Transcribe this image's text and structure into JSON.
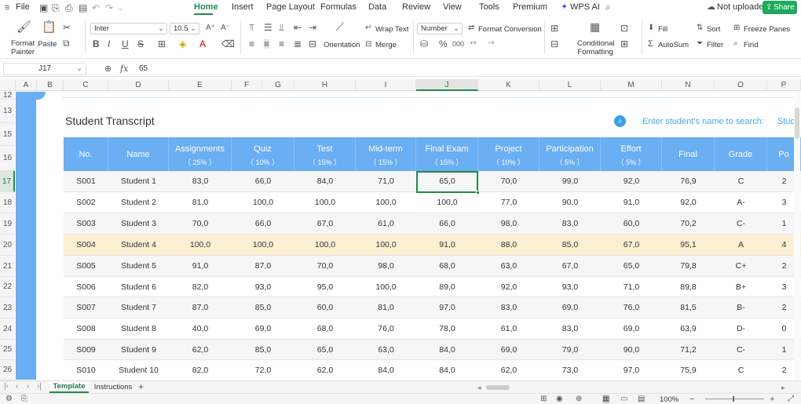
{
  "menu": {
    "file": "File",
    "tabs": [
      "Home",
      "Insert",
      "Page Layout",
      "Formulas",
      "Data",
      "Review",
      "View",
      "Tools",
      "Premium"
    ],
    "active_tab": "Home",
    "wps_ai": "WPS AI",
    "not_uploaded": "Not uploaded",
    "share": "Share"
  },
  "ribbon": {
    "format_painter": "Format Painter",
    "paste": "Paste",
    "font_name": "Inter",
    "font_size": "10.5",
    "wrap_text": "Wrap Text",
    "orientation": "Orientation",
    "merge": "Merge",
    "number_format": "Number",
    "format_conversion": "Format Conversion",
    "conditional_formatting": "Conditional Formatting",
    "fill": "Fill",
    "sort": "Sort",
    "freeze_panes": "Freeze Panes",
    "autosum": "AutoSum",
    "filter": "Filter",
    "find": "Find"
  },
  "formula_bar": {
    "cell_ref": "J17",
    "fx": "fx",
    "value": "65"
  },
  "column_headers": [
    "A",
    "B",
    "C",
    "D",
    "E",
    "F",
    "G",
    "H",
    "I",
    "J",
    "K",
    "L",
    "M",
    "N",
    "O",
    "P"
  ],
  "row_numbers": [
    "12",
    "13",
    "15",
    "16",
    "17",
    "18",
    "19",
    "20",
    "21",
    "22",
    "23",
    "24",
    "25",
    "26"
  ],
  "sheet": {
    "title": "Student Transcript",
    "search_label": "Enter student's name to search:",
    "search_value": "Stud",
    "headers": [
      {
        "name": "No.",
        "weight": ""
      },
      {
        "name": "Name",
        "weight": ""
      },
      {
        "name": "Assignments",
        "weight": "（ 25% ）"
      },
      {
        "name": "Quiz",
        "weight": "（ 10% ）"
      },
      {
        "name": "Test",
        "weight": "（ 15% ）"
      },
      {
        "name": "Mid-term",
        "weight": "（ 15% ）"
      },
      {
        "name": "Final Exam",
        "weight": "（ 15% ）"
      },
      {
        "name": "Project",
        "weight": "（ 10% ）"
      },
      {
        "name": "Participation",
        "weight": "（ 5% ）"
      },
      {
        "name": "Effort",
        "weight": "（ 5% ）"
      },
      {
        "name": "Final",
        "weight": ""
      },
      {
        "name": "Grade",
        "weight": ""
      },
      {
        "name": "Po",
        "weight": ""
      }
    ],
    "rows": [
      [
        "S001",
        "Student 1",
        "83,0",
        "66,0",
        "84,0",
        "71,0",
        "65,0",
        "70,0",
        "99,0",
        "92,0",
        "76,9",
        "C",
        "2"
      ],
      [
        "S002",
        "Student 2",
        "81,0",
        "100,0",
        "100,0",
        "100,0",
        "100,0",
        "77,0",
        "90,0",
        "91,0",
        "92,0",
        "A-",
        "3"
      ],
      [
        "S003",
        "Student 3",
        "70,0",
        "66,0",
        "67,0",
        "61,0",
        "66,0",
        "98,0",
        "83,0",
        "60,0",
        "70,2",
        "C-",
        "1"
      ],
      [
        "S004",
        "Student 4",
        "100,0",
        "100,0",
        "100,0",
        "100,0",
        "91,0",
        "88,0",
        "85,0",
        "67,0",
        "95,1",
        "A",
        "4"
      ],
      [
        "S005",
        "Student 5",
        "91,0",
        "87,0",
        "70,0",
        "98,0",
        "68,0",
        "63,0",
        "67,0",
        "65,0",
        "79,8",
        "C+",
        "2"
      ],
      [
        "S006",
        "Student 6",
        "82,0",
        "93,0",
        "95,0",
        "100,0",
        "89,0",
        "92,0",
        "93,0",
        "71,0",
        "89,8",
        "B+",
        "3"
      ],
      [
        "S007",
        "Student 7",
        "87,0",
        "85,0",
        "60,0",
        "81,0",
        "97,0",
        "83,0",
        "69,0",
        "76,0",
        "81,5",
        "B-",
        "2"
      ],
      [
        "S008",
        "Student 8",
        "40,0",
        "69,0",
        "68,0",
        "76,0",
        "78,0",
        "61,0",
        "83,0",
        "69,0",
        "63,9",
        "D-",
        "0"
      ],
      [
        "S009",
        "Student 9",
        "62,0",
        "85,0",
        "65,0",
        "63,0",
        "84,0",
        "69,0",
        "79,0",
        "90,0",
        "71,2",
        "C-",
        "1"
      ],
      [
        "S010",
        "Student 10",
        "82,0",
        "72,0",
        "62,0",
        "84,0",
        "84,0",
        "62,0",
        "73,0",
        "97,0",
        "75,9",
        "C",
        "2"
      ]
    ]
  },
  "sheet_tabs": [
    "Template",
    "Instructions"
  ],
  "zoom": "100%",
  "colors": {
    "accent": "#1e8c4a",
    "header_blue": "#6aaef3",
    "highlight_row": "#fdf0d2"
  }
}
